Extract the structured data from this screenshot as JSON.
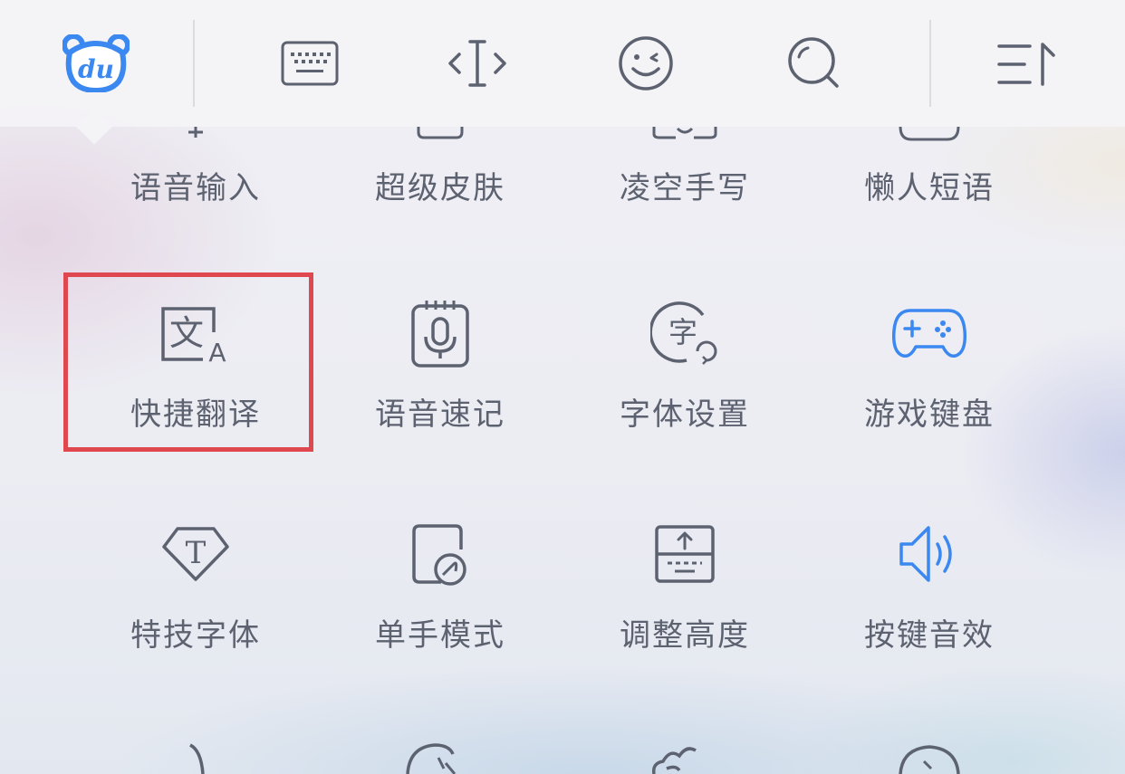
{
  "toolbar": {
    "items": [
      {
        "icon": "du-logo-icon",
        "label": "du"
      },
      {
        "icon": "keyboard-icon"
      },
      {
        "icon": "cursor-move-icon"
      },
      {
        "icon": "emoji-icon"
      },
      {
        "icon": "search-icon"
      },
      {
        "icon": "menu-collapse-icon"
      }
    ],
    "accent_color": "#3b88f0"
  },
  "grid": {
    "rows": [
      [
        "语音输入",
        "超级皮肤",
        "凌空手写",
        "懒人短语"
      ],
      [
        "快捷翻译",
        "语音速记",
        "字体设置",
        "游戏键盘"
      ],
      [
        "特技字体",
        "单手模式",
        "调整高度",
        "按键音效"
      ]
    ],
    "icons": [
      [
        "voice-input-icon",
        "skin-icon",
        "handwriting-icon",
        "phrase-icon"
      ],
      [
        "translate-icon",
        "voice-memo-icon",
        "font-settings-icon",
        "gamepad-icon"
      ],
      [
        "fancy-font-icon",
        "one-hand-icon",
        "adjust-height-icon",
        "key-sound-icon"
      ]
    ],
    "highlighted": "快捷翻译",
    "highlight_color": "#e0484f",
    "icon_color": "#5d6270",
    "active_icon_color": "#3b88f0"
  },
  "translate_icon_glyphs": {
    "main": "文",
    "sub": "A"
  },
  "font_icon_glyph": "字",
  "fancy_font_glyph": "T"
}
